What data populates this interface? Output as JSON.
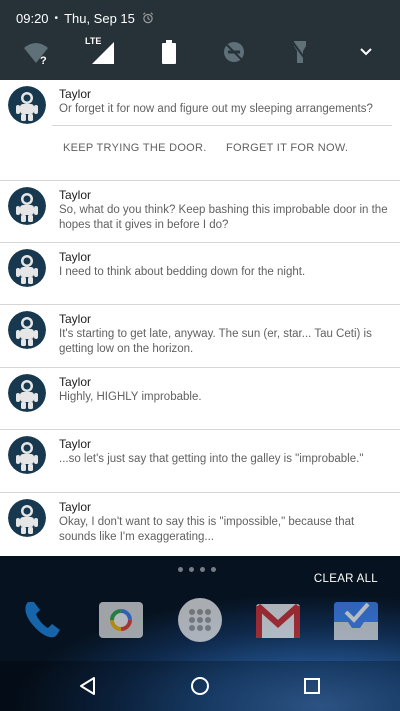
{
  "status": {
    "time": "09:20",
    "separator": "•",
    "date": "Thu, Sep 15"
  },
  "quick_settings": {
    "icons": [
      "wifi-unknown-icon",
      "lte-signal-icon",
      "battery-icon",
      "do-not-disturb-off-icon",
      "flashlight-off-icon",
      "expand-chevron-icon"
    ],
    "lte_label": "LTE"
  },
  "notifications": [
    {
      "sender": "Taylor",
      "message": "Or forget it for now and figure out my sleeping arrangements?",
      "actions": [
        "KEEP TRYING THE DOOR.",
        "FORGET IT FOR NOW."
      ]
    },
    {
      "sender": "Taylor",
      "message": "So, what do you think? Keep bashing this improbable door in the hopes that it gives in before I do?"
    },
    {
      "sender": "Taylor",
      "message": "I need to think about bedding down for the night."
    },
    {
      "sender": "Taylor",
      "message": "It's starting to get late, anyway. The sun (er, star... Tau Ceti) is getting low on the horizon."
    },
    {
      "sender": "Taylor",
      "message": "Highly, HIGHLY improbable."
    },
    {
      "sender": "Taylor",
      "message": "...so let's just say that getting into the galley is \"improbable.\""
    },
    {
      "sender": "Taylor",
      "message": "Okay, I don't want to say this is \"impossible,\" because that sounds like I'm exaggerating..."
    }
  ],
  "home": {
    "clear_all_label": "CLEAR ALL",
    "dock_apps": [
      "phone-icon",
      "camera-icon",
      "app-drawer-icon",
      "gmail-icon",
      "inbox-icon"
    ]
  },
  "navbar": {
    "buttons": [
      "back-icon",
      "home-icon",
      "recents-icon"
    ]
  },
  "colors": {
    "status_bar": "#263238",
    "card_bg": "#ffffff",
    "title_text": "#212121",
    "body_text": "#616161",
    "divider": "#d6d6d6"
  }
}
